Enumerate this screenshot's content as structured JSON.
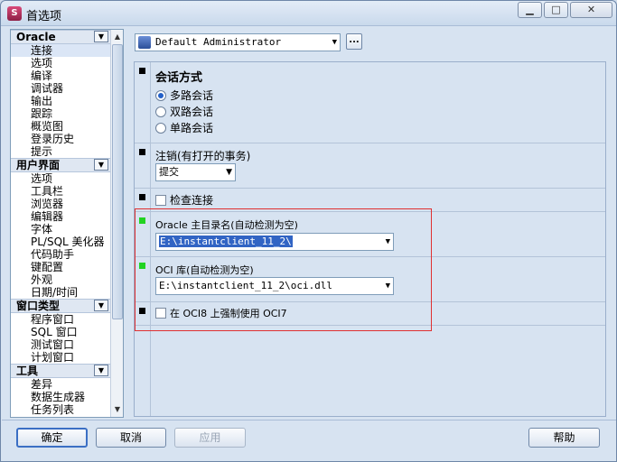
{
  "window": {
    "title": "首选项",
    "app_icon_glyph": "S"
  },
  "nav": {
    "groups": [
      {
        "label": "Oracle",
        "items": [
          "连接",
          "选项",
          "编译",
          "调试器",
          "输出",
          "跟踪",
          "概览图",
          "登录历史",
          "提示"
        ],
        "selected": 0
      },
      {
        "label": "用户界面",
        "items": [
          "选项",
          "工具栏",
          "浏览器",
          "编辑器",
          "字体",
          "PL/SQL 美化器",
          "代码助手",
          "键配置",
          "外观",
          "日期/时间"
        ]
      },
      {
        "label": "窗口类型",
        "items": [
          "程序窗口",
          "SQL 窗口",
          "测试窗口",
          "计划窗口"
        ]
      },
      {
        "label": "工具",
        "items": [
          "差异",
          "数据生成器",
          "任务列表"
        ]
      }
    ]
  },
  "profile": {
    "value": "Default Administrator",
    "more_label": "..."
  },
  "sections": {
    "session": {
      "title": "会话方式",
      "options": [
        "多路会话",
        "双路会话",
        "单路会话"
      ],
      "selected": 0
    },
    "logoff": {
      "title": "注销(有打开的事务)",
      "value": "提交"
    },
    "check": {
      "label": "检查连接"
    },
    "oracle_home": {
      "title": "Oracle 主目录名(自动检测为空)",
      "value": "E:\\instantclient_11_2\\"
    },
    "oci": {
      "title": "OCI 库(自动检测为空)",
      "value": "E:\\instantclient_11_2\\oci.dll"
    },
    "force_oci7": {
      "label": "在 OCI8 上强制使用 OCI7"
    }
  },
  "buttons": {
    "ok": "确定",
    "cancel": "取消",
    "apply": "应用",
    "help": "帮助"
  },
  "colors": {
    "accent": "#3164c4",
    "highlight_box": "#e03030",
    "marker_green": "#22d322"
  }
}
